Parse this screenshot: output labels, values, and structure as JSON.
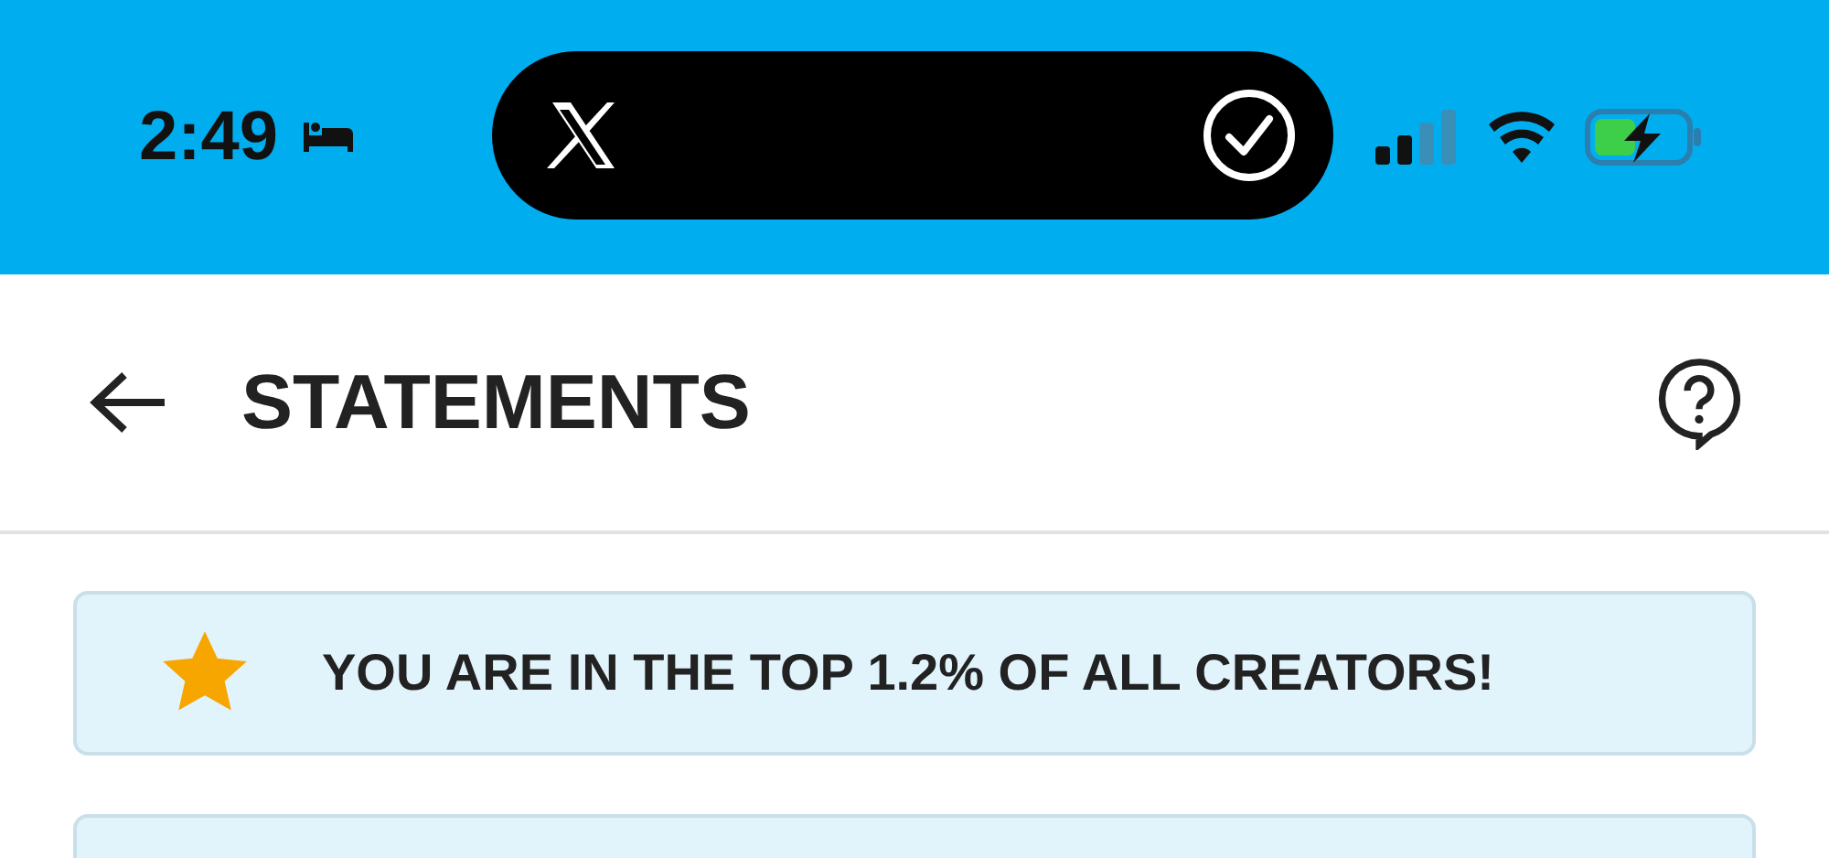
{
  "status_bar": {
    "time": "2:49"
  },
  "header": {
    "title": "STATEMENTS"
  },
  "banner": {
    "text": "YOU ARE IN THE TOP 1.2% OF ALL CREATORS!"
  }
}
